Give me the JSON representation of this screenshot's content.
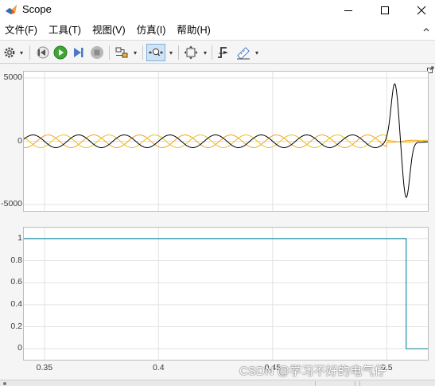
{
  "window": {
    "title": "Scope",
    "icon": "matlab-icon",
    "controls": [
      "minimize-icon",
      "maximize-icon",
      "close-icon"
    ]
  },
  "menu": {
    "items": [
      "文件(F)",
      "工具(T)",
      "视图(V)",
      "仿真(I)",
      "帮助(H)"
    ]
  },
  "toolbar": {
    "buttons": [
      {
        "name": "configuration-properties",
        "icon": "gear-icon",
        "dropdown": true
      },
      {
        "name": "step-back",
        "icon": "step-back-icon"
      },
      {
        "name": "run",
        "icon": "run-icon",
        "color": "#3fa535"
      },
      {
        "name": "step-forward",
        "icon": "step-forward-icon"
      },
      {
        "name": "stop",
        "icon": "stop-icon"
      },
      {
        "name": "highlight-block",
        "icon": "highlight-icon",
        "dropdown": true
      },
      {
        "name": "zoom-x",
        "icon": "zoom-x-icon",
        "dropdown": true,
        "active": true
      },
      {
        "name": "autoscale",
        "icon": "autoscale-icon",
        "dropdown": true
      },
      {
        "name": "triggers",
        "icon": "trigger-icon"
      },
      {
        "name": "cursor-measurements",
        "icon": "cursor-measure-icon",
        "dropdown": true
      }
    ]
  },
  "colors": {
    "series_black": "#000000",
    "series_orange": "#f7a01b",
    "series_yellow": "#e6c419",
    "series_teal": "#1f8ea8",
    "grid": "#e2e2e2"
  },
  "chart_data": [
    {
      "type": "line",
      "title": "",
      "xlabel": "",
      "ylabel": "",
      "xlim": [
        0.341,
        0.518
      ],
      "ylim": [
        -5500,
        5500
      ],
      "x_ticks": [
        "0.35",
        "0.4",
        "0.45",
        "0.5"
      ],
      "y_ticks": [
        "5000",
        "0",
        "-5000"
      ],
      "grid": true,
      "legend": false,
      "series": [
        {
          "color": "#000000",
          "description": "three-phase sinusoid ~500 amplitude before 0.5, then large transient peaking ~4500 / ~-4500 near 0.503-0.508, then ~0"
        },
        {
          "color": "#f7a01b"
        },
        {
          "color": "#e6c419"
        }
      ],
      "sine_period": 0.02,
      "sine_amplitude": 500,
      "fault_time": 0.5,
      "transient_peak": 4500,
      "transient_trough": -4500,
      "post_fault_amplitude": 80
    },
    {
      "type": "line",
      "title": "",
      "xlabel": "",
      "ylabel": "",
      "xlim": [
        0.341,
        0.518
      ],
      "ylim": [
        -0.1,
        1.1
      ],
      "x_ticks": [
        "0.35",
        "0.4",
        "0.45",
        "0.5"
      ],
      "y_ticks": [
        "1",
        "0.8",
        "0.6",
        "0.4",
        "0.2",
        "0"
      ],
      "grid": true,
      "legend": false,
      "series": [
        {
          "color": "#1f8ea8",
          "x": [
            0.341,
            0.5085,
            0.5085,
            0.518
          ],
          "y": [
            1,
            1,
            0,
            0
          ]
        }
      ]
    }
  ],
  "watermark": "CSDN @学习不好的电气仔",
  "status": {
    "segments": [
      "",
      "",
      ""
    ]
  }
}
